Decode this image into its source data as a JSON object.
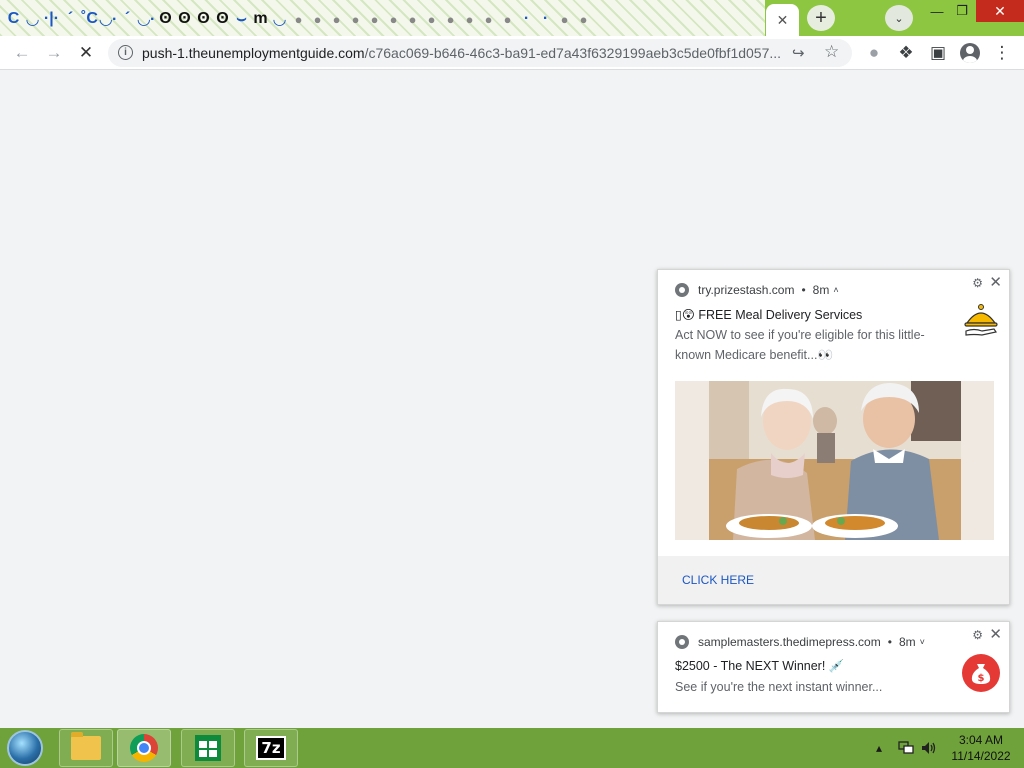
{
  "browser": {
    "tab_icons": [
      "C",
      "◡",
      "·|·",
      "´",
      "˚C",
      "◡·",
      "´",
      "◡·",
      "ʘ",
      "ʘ",
      "ʘ",
      "ʘ",
      "⌣",
      "m",
      "◡",
      "●",
      "●",
      "●",
      "●",
      "●",
      "●",
      "●",
      "●",
      "●",
      "●",
      "●",
      "●",
      "·",
      "·",
      "●",
      "●"
    ],
    "active_tab_close": "✕",
    "new_tab": "+",
    "tab_search": "⌄",
    "window": {
      "minimize": "—",
      "maximize": "❐",
      "close": "✕"
    },
    "toolbar": {
      "back": "←",
      "forward": "→",
      "stop": "✕",
      "url_host": "push-1.theunemploymentguide.com",
      "url_rest": "/c76ac069-b646-46c3-ba91-ed7a43f6329199aeb3c5de0fbf1d057...",
      "share": "↪",
      "star": "☆",
      "extension": "●",
      "puzzle": "❖",
      "sidepanel": "▣",
      "menu": "⋮"
    }
  },
  "notifications": [
    {
      "origin": "try.prizestash.com",
      "time": "8m",
      "caret": "˄",
      "title": "▯😲 FREE Meal Delivery Services",
      "body": "Act NOW to see if you're eligible for this little-known Medicare benefit...👀",
      "action": "CLICK HERE",
      "icon": "cloche-icon"
    },
    {
      "origin": "samplemasters.thedimepress.com",
      "time": "8m",
      "caret": "˅",
      "title": "$2500 - The NEXT Winner! 💉",
      "body": "See if you're the next instant winner...",
      "icon": "money-bag-icon"
    }
  ],
  "taskbar": {
    "apps": [
      "file-explorer",
      "chrome",
      "store",
      "7zip"
    ],
    "sevenzip_label": "7z",
    "tray_up": "▴",
    "time": "3:04 AM",
    "date": "11/14/2022",
    "bag_symbol": "$"
  },
  "colors": {
    "taskbar": "#6fa23a",
    "tab_strip": "#8dc641",
    "notif_action": "#1a56c4",
    "close_red": "#c42b1c"
  }
}
